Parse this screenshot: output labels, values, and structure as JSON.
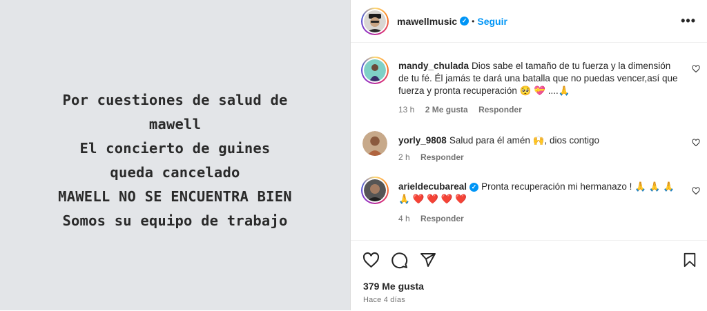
{
  "story": {
    "lines": [
      "Por cuestiones de salud de",
      "mawell",
      "El concierto de guines",
      "queda cancelado",
      "MAWELL NO SE ENCUENTRA BIEN",
      "Somos su equipo de trabajo"
    ]
  },
  "header": {
    "username": "mawellmusic",
    "separator": "•",
    "follow_label": "Seguir",
    "more_label": "•••"
  },
  "comments": [
    {
      "username": "mandy_chulada",
      "text": "Dios sabe el tamaño de tu fuerza y la dimensión de tu fé. Él jamás te dará una batalla que no puedas vencer,así que fuerza y pronta recuperación 🥺 💝 ....🙏",
      "time": "13 h",
      "likes": "2 Me gusta",
      "reply": "Responder"
    },
    {
      "username": "yorly_9808",
      "text": "Salud para él amén 🙌, dios contigo",
      "time": "2 h",
      "reply": "Responder"
    },
    {
      "username": "arieldecubareal",
      "text": "Pronta recuperación mi hermanazo ! 🙏 🙏 🙏 🙏 ❤️ ❤️ ❤️ ❤️",
      "time": "4 h",
      "reply": "Responder"
    }
  ],
  "footer": {
    "likes": "379 Me gusta",
    "time": "Hace 4 días"
  },
  "icons": [
    "heart-icon",
    "comment-icon",
    "share-icon",
    "save-icon",
    "more-icon",
    "verified-icon"
  ],
  "colors": {
    "link": "#0095f6",
    "text": "#262626",
    "muted": "#737373",
    "media_bg": "#e3e5e8"
  }
}
